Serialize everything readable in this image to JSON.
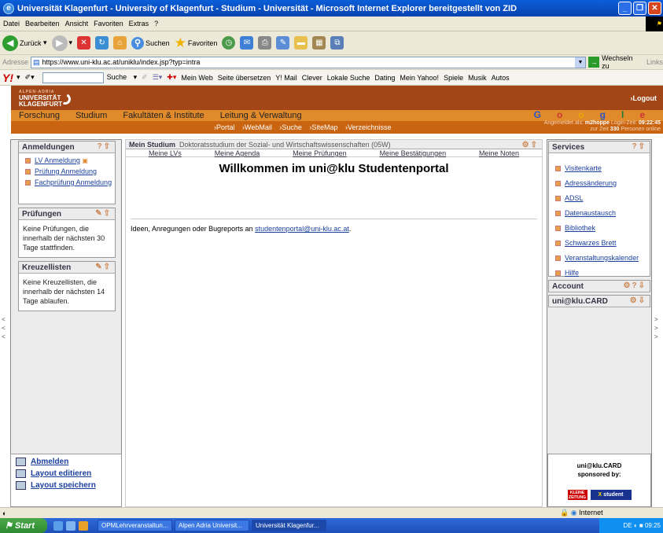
{
  "window": {
    "title": "Universität Klagenfurt - University of Klagenfurt - Studium - Universität - Microsoft Internet Explorer bereitgestellt von ZID"
  },
  "menu": {
    "items": [
      "Datei",
      "Bearbeiten",
      "Ansicht",
      "Favoriten",
      "Extras",
      "?"
    ]
  },
  "toolbar": {
    "back": "Zurück",
    "search": "Suchen",
    "favorites": "Favoriten"
  },
  "address": {
    "label": "Adresse",
    "url": "https://www.uni-klu.ac.at/uniklu/index.jsp?typ=intra",
    "go": "Wechseln zu",
    "links": "Links"
  },
  "yahoo_toolbar": {
    "search": "Suche",
    "items": [
      "Mein Web",
      "Seite übersetzen",
      "Y! Mail",
      "Clever",
      "Lokale Suche",
      "Dating",
      "Mein Yahoo!",
      "Spiele",
      "Musik",
      "Autos"
    ]
  },
  "site": {
    "logo_top": "ALPEN-ADRIA",
    "logo_line1": "UNIVERSITÄT",
    "logo_line2": "KLAGENFURT",
    "logout": "›Logout",
    "nav": [
      "Forschung",
      "Studium",
      "Fakultäten & Institute",
      "Leitung & Verwaltung"
    ],
    "subnav": [
      "›Portal",
      "›WebMail",
      "›Suche",
      "›SiteMap",
      "›Verzeichnisse"
    ],
    "login_info_line1_prefix": "Angemeldet als:",
    "login_user": "m2hoppe",
    "login_time_label": "Login-Zeit:",
    "login_time": "09:22:45",
    "online_prefix": "zur Zeit",
    "online_count": "330",
    "online_suffix": "Personen online",
    "google": [
      "G",
      "o",
      "o",
      "g",
      "l",
      "e"
    ]
  },
  "left": {
    "anmeldungen": {
      "title": "Anmeldungen",
      "items": [
        "LV Anmeldung",
        "Prüfung Anmeldung",
        "Fachprüfung Anmeldung"
      ]
    },
    "pruefungen": {
      "title": "Prüfungen",
      "text": "Keine Prüfungen, die innerhalb der nächsten 30 Tage stattfinden."
    },
    "kreuzellisten": {
      "title": "Kreuzellisten",
      "text": "Keine Kreuzellisten, die innerhalb der nächsten 14 Tage ablaufen."
    },
    "bottom": [
      "Abmelden",
      "Layout editieren",
      "Layout speichern"
    ]
  },
  "center": {
    "title": "Mein Studium",
    "subtitle": "Doktoratsstudium der Sozial- und Wirtschaftswissenschaften (05W)",
    "tabs": [
      "Meine LVs",
      "Meine Agenda",
      "Meine Prüfungen",
      "Meine Bestätigungen",
      "Meine Noten"
    ],
    "welcome": "Willkommen im uni@klu Studentenportal",
    "ideas_text": "Ideen, Anregungen oder Bugreports an",
    "ideas_email": "studentenportal@uni-klu.ac.at",
    "ideas_end": "."
  },
  "right": {
    "services": {
      "title": "Services",
      "items": [
        "Visitenkarte",
        "Adressänderung",
        "ADSL",
        "Datenaustausch",
        "Bibliothek",
        "Schwarzes Brett",
        "Veranstaltungskalender",
        "Hilfe"
      ]
    },
    "account": {
      "title": "Account"
    },
    "card": {
      "title": "uni@klu.CARD"
    },
    "sponsor_line1": "uni@klu.CARD",
    "sponsor_line2": "sponsored by:",
    "sponsor_logo1": "KLEINE ZEITUNG",
    "sponsor_logo2_x": "X",
    "sponsor_logo2_top": "student",
    "sponsor_logo2_bottom": "corner"
  },
  "status": {
    "zone": "Internet"
  },
  "taskbar": {
    "start": "Start",
    "tasks": [
      "OPMLehrveranstaltun...",
      "Alpen Adria Universit...",
      "Universität Klagenfur..."
    ],
    "lang": "DE",
    "time": "09:25"
  },
  "colors": {
    "brand": "#a24617",
    "nav": "#e08a2c",
    "subnav": "#c96410",
    "link": "#1a3f9c"
  }
}
